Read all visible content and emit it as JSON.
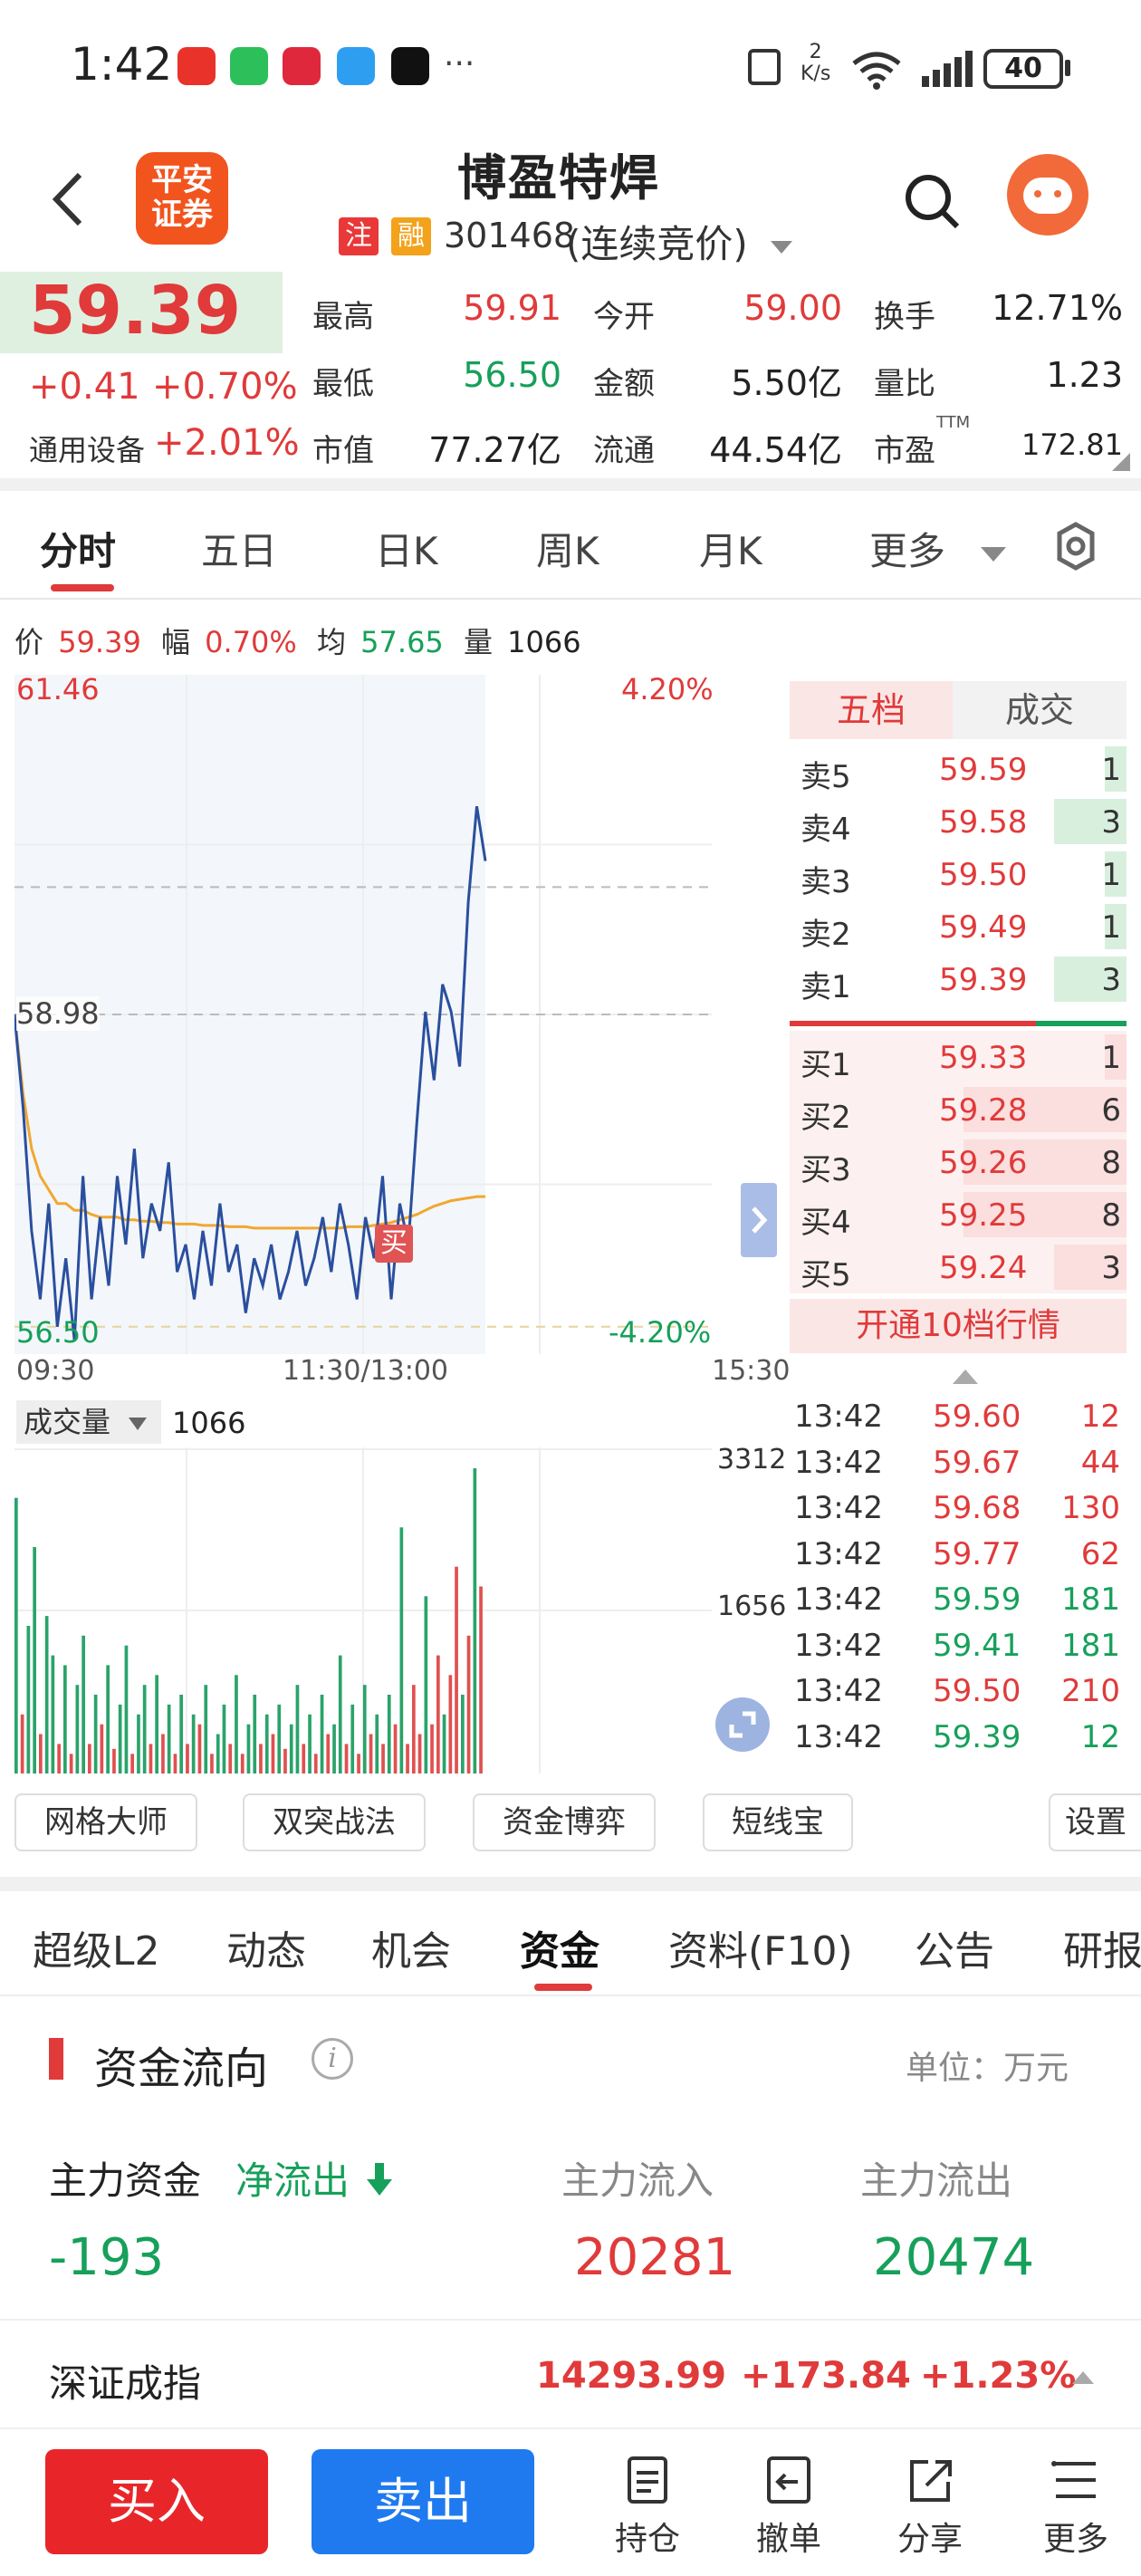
{
  "status_bar": {
    "time": "1:42",
    "more": "···",
    "net_speed_top": "2",
    "net_speed_bottom": "K/s",
    "wifi_label": "6",
    "battery": "40"
  },
  "header": {
    "logo_line1": "平安",
    "logo_line2": "证券",
    "stock_name": "博盈特焊",
    "badge_zhu": "注",
    "badge_rong": "融",
    "stock_code": "301468",
    "trade_mode": "(连续竞价)"
  },
  "quote": {
    "price": "59.39",
    "change": "+0.41",
    "change_pct": "+0.70%",
    "sector": "通用设备",
    "sector_pct": "+2.01%",
    "high_label": "最高",
    "high": "59.91",
    "open_label": "今开",
    "open": "59.00",
    "turnover_label": "换手",
    "turnover": "12.71%",
    "low_label": "最低",
    "low": "56.50",
    "amount_label": "金额",
    "amount": "5.50亿",
    "vol_ratio_label": "量比",
    "vol_ratio": "1.23",
    "mktcap_label": "市值",
    "mktcap": "77.27亿",
    "float_label": "流通",
    "float": "44.54亿",
    "pe_label": "市盈",
    "pe_sup": "TTM",
    "pe": "172.81"
  },
  "chart_tabs": [
    "分时",
    "五日",
    "日K",
    "周K",
    "月K",
    "更多"
  ],
  "chart_info": {
    "price_label": "价",
    "price": "59.39",
    "range_label": "幅",
    "range": "0.70%",
    "avg_label": "均",
    "avg": "57.65",
    "vol_label": "量",
    "vol": "1066"
  },
  "chart_data": {
    "type": "line",
    "y_top": "61.46",
    "y_top_pct": "4.20%",
    "y_mid": "58.98",
    "y_bottom": "56.50",
    "y_bottom_pct": "-4.20%",
    "x_labels": [
      "09:30",
      "11:30/13:00",
      "15:30"
    ],
    "ylim": [
      56.5,
      61.46
    ],
    "prev_close": 58.98,
    "price_series": [
      58.98,
      58.3,
      57.4,
      56.9,
      57.6,
      56.7,
      57.2,
      56.6,
      57.8,
      56.9,
      57.5,
      57.0,
      57.8,
      57.3,
      58.0,
      57.2,
      57.6,
      57.4,
      57.9,
      57.1,
      57.3,
      56.9,
      57.4,
      57.0,
      57.6,
      57.1,
      57.3,
      56.8,
      57.2,
      57.0,
      57.3,
      56.9,
      57.1,
      57.4,
      57.0,
      57.2,
      57.5,
      57.1,
      57.6,
      57.3,
      56.9,
      57.5,
      57.2,
      57.8,
      56.9,
      57.6,
      57.3,
      58.2,
      59.0,
      58.5,
      59.2,
      59.0,
      58.6,
      59.8,
      60.5,
      60.1
    ],
    "avg_series": [
      58.98,
      58.4,
      58.0,
      57.8,
      57.7,
      57.6,
      57.6,
      57.55,
      57.55,
      57.52,
      57.5,
      57.5,
      57.5,
      57.48,
      57.48,
      57.47,
      57.47,
      57.46,
      57.46,
      57.45,
      57.45,
      57.45,
      57.44,
      57.44,
      57.44,
      57.43,
      57.43,
      57.43,
      57.42,
      57.42,
      57.42,
      57.42,
      57.42,
      57.42,
      57.42,
      57.42,
      57.42,
      57.42,
      57.42,
      57.43,
      57.43,
      57.43,
      57.44,
      57.45,
      57.46,
      57.48,
      57.5,
      57.52,
      57.55,
      57.58,
      57.6,
      57.62,
      57.63,
      57.64,
      57.65,
      57.65
    ],
    "buy_marker": "买",
    "volume_label": "成交量",
    "volume_current": "1066",
    "volume_axis": [
      "3312",
      "1656"
    ],
    "volume_values": [
      2800,
      600,
      1500,
      2300,
      400,
      1600,
      1200,
      300,
      1100,
      200,
      900,
      1400,
      300,
      800,
      500,
      1100,
      250,
      700,
      1300,
      200,
      600,
      900,
      300,
      1000,
      400,
      700,
      200,
      800,
      300,
      600,
      500,
      900,
      200,
      400,
      700,
      300,
      1000,
      200,
      500,
      800,
      300,
      600,
      400,
      700,
      250,
      500,
      900,
      300,
      600,
      200,
      800,
      400,
      500,
      1200,
      300,
      700,
      200,
      900,
      400,
      600,
      300,
      800,
      500,
      2500,
      300,
      900,
      400,
      1800,
      500,
      1200,
      600,
      1000,
      2100,
      800,
      1400,
      3100,
      1900
    ],
    "volume_colors": [
      "g",
      "r",
      "g",
      "g",
      "r",
      "g",
      "g",
      "r",
      "g",
      "r",
      "g",
      "g",
      "r",
      "g",
      "r",
      "g",
      "r",
      "g",
      "g",
      "r",
      "g",
      "g",
      "r",
      "g",
      "r",
      "g",
      "r",
      "g",
      "r",
      "g",
      "r",
      "g",
      "r",
      "g",
      "g",
      "r",
      "g",
      "r",
      "g",
      "g",
      "r",
      "g",
      "r",
      "g",
      "r",
      "g",
      "g",
      "r",
      "g",
      "r",
      "g",
      "r",
      "g",
      "g",
      "r",
      "g",
      "r",
      "g",
      "r",
      "g",
      "r",
      "g",
      "r",
      "g",
      "r",
      "r",
      "r",
      "g",
      "r",
      "r",
      "g",
      "r",
      "r",
      "g",
      "r",
      "g",
      "r"
    ]
  },
  "order_book": {
    "tabs": [
      "五档",
      "成交"
    ],
    "asks": [
      {
        "label": "卖5",
        "price": "59.59",
        "vol": "1"
      },
      {
        "label": "卖4",
        "price": "59.58",
        "vol": "3"
      },
      {
        "label": "卖3",
        "price": "59.50",
        "vol": "1"
      },
      {
        "label": "卖2",
        "price": "59.49",
        "vol": "1"
      },
      {
        "label": "卖1",
        "price": "59.39",
        "vol": "3"
      }
    ],
    "bids": [
      {
        "label": "买1",
        "price": "59.33",
        "vol": "1"
      },
      {
        "label": "买2",
        "price": "59.28",
        "vol": "6"
      },
      {
        "label": "买3",
        "price": "59.26",
        "vol": "8"
      },
      {
        "label": "买4",
        "price": "59.25",
        "vol": "8"
      },
      {
        "label": "买5",
        "price": "59.24",
        "vol": "3"
      }
    ],
    "open_level10": "开通10档行情"
  },
  "ticks": [
    {
      "time": "13:42",
      "price": "59.60",
      "vol": "12",
      "c": "r"
    },
    {
      "time": "13:42",
      "price": "59.67",
      "vol": "44",
      "c": "r"
    },
    {
      "time": "13:42",
      "price": "59.68",
      "vol": "130",
      "c": "r"
    },
    {
      "time": "13:42",
      "price": "59.77",
      "vol": "62",
      "c": "r"
    },
    {
      "time": "13:42",
      "price": "59.59",
      "vol": "181",
      "c": "g"
    },
    {
      "time": "13:42",
      "price": "59.41",
      "vol": "181",
      "c": "g"
    },
    {
      "time": "13:42",
      "price": "59.50",
      "vol": "210",
      "c": "r"
    },
    {
      "time": "13:42",
      "price": "59.39",
      "vol": "12",
      "c": "g"
    }
  ],
  "tools": [
    "网格大师",
    "双突战法",
    "资金博弈",
    "短线宝",
    "设置"
  ],
  "news_tabs": [
    "超级L2",
    "动态",
    "机会",
    "资金",
    "资料(F10)",
    "公告",
    "研报"
  ],
  "fund_flow": {
    "title": "资金流向",
    "unit": "单位：万元",
    "main_label": "主力资金",
    "net_label": "净流出",
    "net_value": "-193",
    "inflow_label": "主力流入",
    "inflow": "20281",
    "outflow_label": "主力流出",
    "outflow": "20474"
  },
  "index_bar": {
    "name": "深证成指",
    "value": "14293.99",
    "change": "+173.84",
    "pct": "+1.23%"
  },
  "bottom_bar": {
    "buy": "买入",
    "sell": "卖出",
    "items": [
      "持仓",
      "撤单",
      "分享",
      "更多"
    ]
  }
}
